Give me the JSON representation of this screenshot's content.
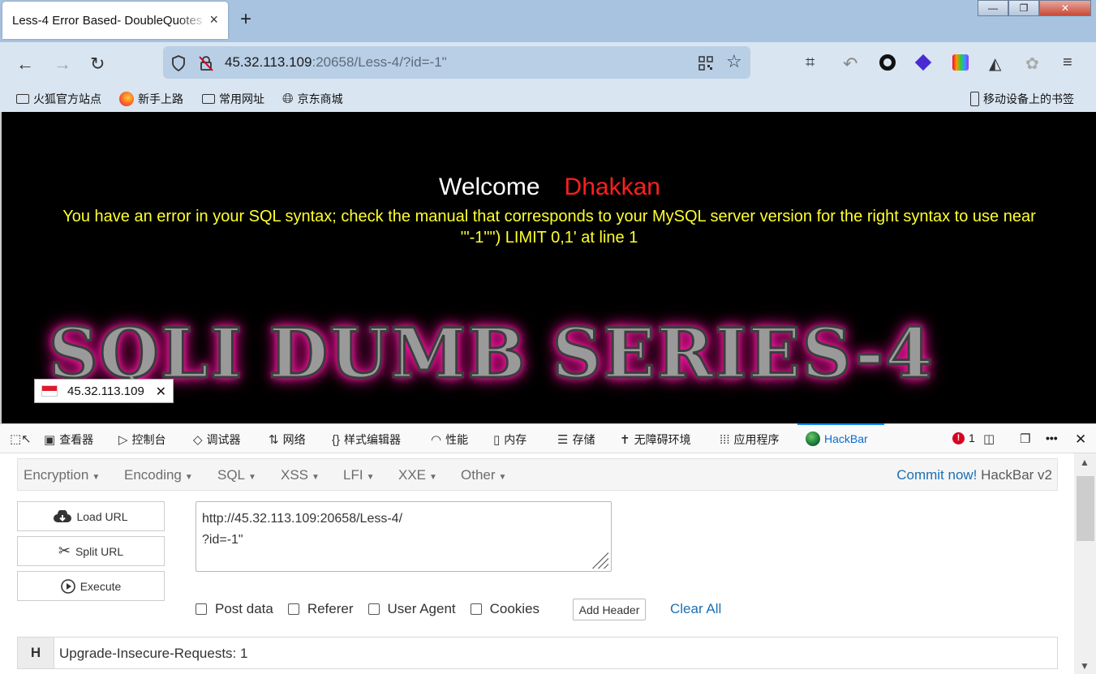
{
  "tab": {
    "title": "Less-4 Error Based- DoubleQuotes",
    "close": "×",
    "new_tab": "+"
  },
  "window": {
    "minimize": "—",
    "maximize": "❐",
    "close": "✕"
  },
  "nav": {
    "url_host": "45.32.113.109",
    "url_rest": ":20658/Less-4/?id=-1\"",
    "icons": [
      "back-icon",
      "forward-icon",
      "reload-icon",
      "shield-icon",
      "insecure-lock-icon",
      "qr-code-icon",
      "star-icon",
      "crop-icon",
      "undo-icon",
      "circle-icon",
      "layers-icon",
      "extension-icon",
      "hacker-icon",
      "puzzle-icon",
      "menu-icon"
    ]
  },
  "bookmarks": {
    "items": [
      "火狐官方站点",
      "新手上路",
      "常用网址",
      "京东商城"
    ],
    "mobile": "移动设备上的书签"
  },
  "page": {
    "welcome": "Welcome",
    "name": "Dhakkan",
    "error_line1": "You have an error in your SQL syntax; check the manual that corresponds to your MySQL server version for the right syntax to use near",
    "error_line2": "'\"-1\"\") LIMIT 0,1' at line 1",
    "banner": "SQLI DUMB SERIES-4",
    "ip_popup": "45.32.113.109",
    "ip_close": "✕"
  },
  "devtools": {
    "tabs": [
      "查看器",
      "控制台",
      "调试器",
      "网络",
      "样式编辑器",
      "性能",
      "内存",
      "存储",
      "无障碍环境",
      "应用程序",
      "HackBar"
    ],
    "error_count": "1",
    "more": "•••",
    "close": "✕"
  },
  "hackbar": {
    "menu": [
      "Encryption",
      "Encoding",
      "SQL",
      "XSS",
      "LFI",
      "XXE",
      "Other"
    ],
    "commit_link": "Commit now!",
    "commit_rest": " HackBar v2",
    "buttons": {
      "load": "Load URL",
      "split": "Split URL",
      "execute": "Execute"
    },
    "url_value": "http://45.32.113.109:20658/Less-4/\n?id=-1\"",
    "checkboxes": [
      "Post data",
      "Referer",
      "User Agent",
      "Cookies"
    ],
    "add_header": "Add Header",
    "clear_all": "Clear All",
    "header_tag": "H",
    "header_value": "Upgrade-Insecure-Requests: 1"
  }
}
